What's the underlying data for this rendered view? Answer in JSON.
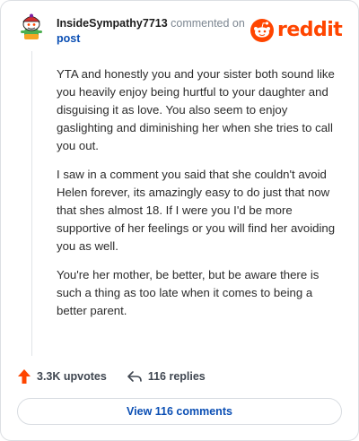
{
  "comment": {
    "username": "InsideSympathy7713",
    "commented_text": "commented on",
    "post_link": "post",
    "paragraphs": [
      "YTA and honestly you and your sister both sound like you heavily enjoy being hurtful to your daughter and disguising it as love. You also seem to enjoy gaslighting and diminishing her when she tries to call you out.",
      "I saw in a comment you said that she couldn't avoid Helen forever, its amazingly easy to do just that now that shes almost 18. If I were you I'd be more supportive of her feelings or you will find her avoiding you as well.",
      "You're her mother, be better, but be aware there is such a thing as too late when it comes to being a better parent."
    ]
  },
  "logo": {
    "text": "reddit",
    "color": "#ff4500"
  },
  "actions": {
    "upvotes": "3.3K upvotes",
    "replies": "116 replies"
  },
  "footer": {
    "view_comments": "View 116 comments"
  },
  "icons": {
    "avatar": "snoo-avatar-icon",
    "logo": "reddit-snoo-icon",
    "upvote": "upvote-arrow-icon",
    "reply": "reply-arrow-icon"
  }
}
